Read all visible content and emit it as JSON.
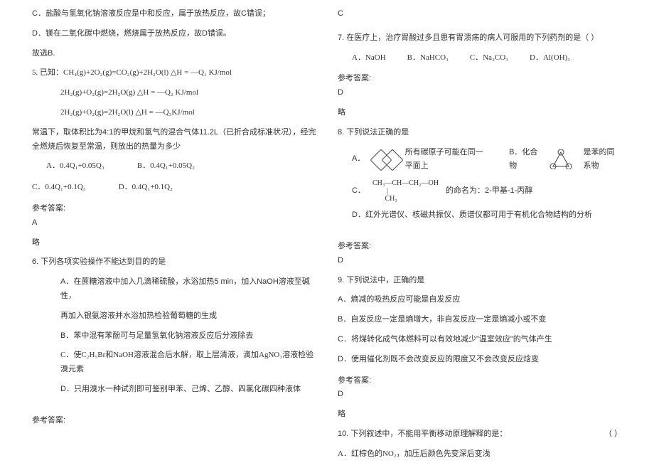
{
  "left": {
    "lC": "C．盐酸与氢氧化钠溶液反应是中和反应，属于放热反应，故C错误；",
    "lD": "D．镁在二氧化碳中燃烧，燃烧属于放热反应，故D错误。",
    "lSel": "故选B.",
    "q5": {
      "stem": "5. 已知：CH₄(g)+2O₂(g)=CO₂(g)+2H₂O(l)      △H = —Q₁ KJ/mol",
      "eq2": "2H₂(g)+O₂(g)=2H₂O(g)              △H = —Q₂ KJ/mol",
      "eq3": "2H₂(g)+O₂(g)=2H₂O(l)              △H = —Q₃KJ/mol",
      "cond": "常温下，取体积比为4:1的甲烷和氢气的混合气体11.2L（已折合成标准状况），经完全燃烧后恢复至常温，则放出的热量为多少",
      "optA": "A．0.4Q₁+0.05Q₃",
      "optB": "B．0.4Q₁+0.05Q₂",
      "optC": "C．0.4Q₁+0.1Q₃",
      "optD": "D．0.4Q₁+0.1Q₂",
      "ansLabel": "参考答案:",
      "ans": "A",
      "略": "略"
    },
    "q6": {
      "stem": "6. 下列各项实验操作不能达到目的的是",
      "a1": "A．在蔗糖溶液中加入几滴稀硫酸，水浴加热5 min，加入NaOH溶液至碱性，",
      "a1b": "再加入银氨溶液并水浴加热检验葡萄糖的生成",
      "b": "B．苯中混有苯酚可与足量氢氧化钠溶液反应后分液除去",
      "c": "C．使C₂H₅Br和NaOH溶液混合后水解，取上层清液，滴加AgNO₃溶液检验溴元素",
      "d": "D．只用溴水一种试剂即可鉴别甲苯、己烯、乙醇、四氯化碳四种液体",
      "ansLabel": "参考答案:"
    }
  },
  "right": {
    "cAns": "C",
    "q7": {
      "stem": "7. 在医疗上，治疗胃酸过多且患有胃溃疡的病人可服用的下列药剂的是（    ）",
      "a": "A．NaOH",
      "b": "B．NaHCO₃",
      "c": "C．Na₂CO₃",
      "d": "D．Al(OH)₃",
      "ansLabel": "参考答案:",
      "ans": "D",
      "略": "略"
    },
    "q8": {
      "stem": "8. 下列说法正确的是",
      "aText": "所有碳原子可能在同一平面上",
      "aPrefix": "A．",
      "bPrefix": "B．化合物",
      "bText": "是苯的同系物",
      "c1": "C．",
      "cStruct1": "CH₃—CH—CH₂—OH",
      "cStruct2": "        |",
      "cStruct3": "       CH₃",
      "cText": "的命名为：2-甲基-1-丙醇",
      "d": "D．红外光谱仪、核磁共振仪、质谱仪都可用于有机化合物结构的分析",
      "ansLabel": "参考答案:",
      "ans": "D"
    },
    "q9": {
      "stem": "9. 下列说法中，正确的是",
      "a": "A．熵减的吸热反应可能是自发反应",
      "b": "B．自发反应一定是熵增大，非自发反应一定是熵减小或不变",
      "c": "C．将煤转化成气体燃料可以有效地减少\"温室效应\"的气体产生",
      "d": "D．使用催化剂既不会改变反应的限度又不会改变反应焓变",
      "ansLabel": "参考答案:",
      "ans": "D",
      "略": "略"
    },
    "q10": {
      "stem": "10. 下列叙述中，不能用平衡移动原理解释的是：",
      "paren": "（    ）",
      "a": "A．红棕色的NO₂，加压后颜色先变深后变浅"
    }
  }
}
